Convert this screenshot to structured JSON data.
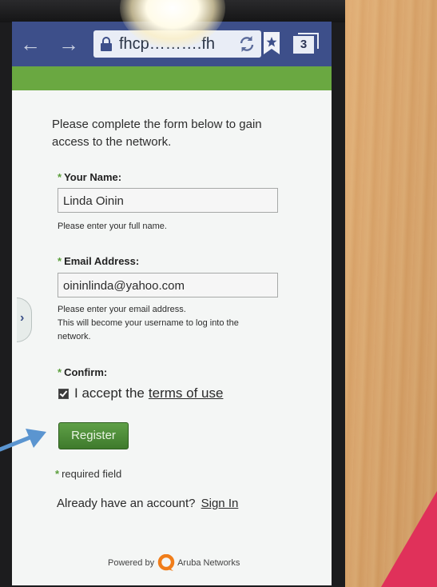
{
  "browser": {
    "url": "fhcp……….fh",
    "tab_count": "3",
    "icons": [
      "back-arrow-icon",
      "forward-arrow-icon",
      "lock-icon",
      "refresh-icon",
      "bookmark-star-icon",
      "tabs-icon"
    ]
  },
  "form": {
    "intro": "Please complete the form below to gain access to the network.",
    "required_marker": "*",
    "name_label": "Your Name:",
    "name_value": "Linda Oinin",
    "name_help": "Please enter your full name.",
    "email_label": "Email Address:",
    "email_value": "oininlinda@yahoo.com",
    "email_help_1": "Please enter your email address.",
    "email_help_2": "This will become your username to log into the",
    "email_help_3": "network.",
    "confirm_label": "Confirm:",
    "accept_text": "I accept the",
    "terms_link": "terms of use",
    "accept_checked": true,
    "register_button": "Register",
    "required_note": "required field",
    "account_text": "Already have an account?",
    "signin_link": "Sign In"
  },
  "footer": {
    "powered_by": "Powered by",
    "brand": "Aruba Networks"
  },
  "colors": {
    "toolbar": "#3d4f8a",
    "green_bar": "#6aa841",
    "register_button": "#4f8d38",
    "required_star": "#5a9e3a",
    "arrow": "#5b95d0"
  }
}
